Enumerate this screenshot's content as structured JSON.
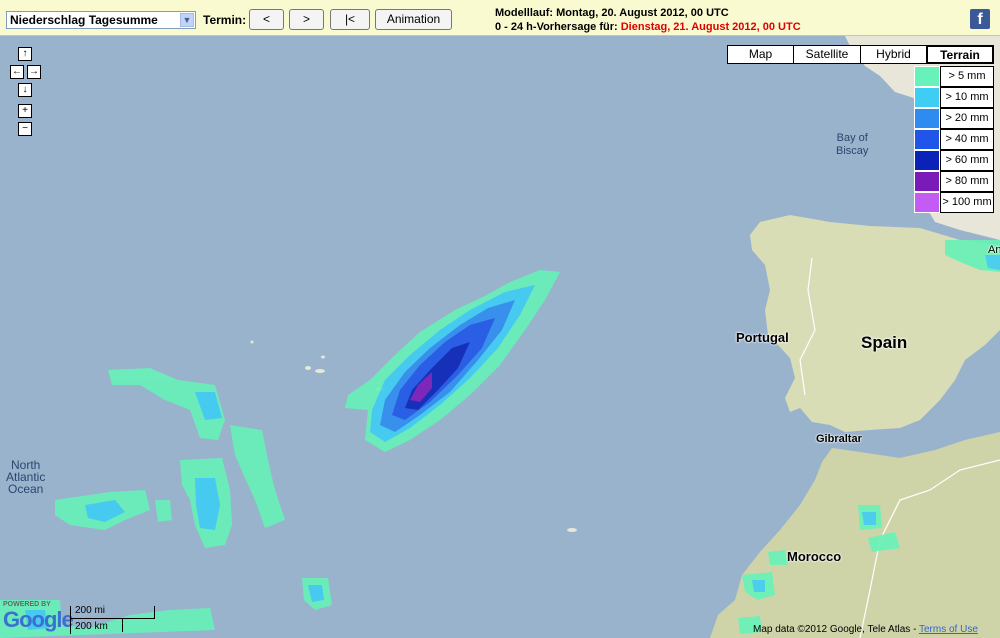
{
  "toolbar": {
    "product_select": "Niederschlag Tagesumme",
    "termin_label": "Termin:",
    "prev_label": "<",
    "next_label": ">",
    "first_label": "|<",
    "animation_label": "Animation",
    "modelllauf": "Modelllauf: Montag, 20. August 2012, 00 UTC",
    "vorhersage_prefix": "0 - 24 h-Vorhersage für:",
    "vorhersage_date": "Dienstag, 21. August 2012, 00 UTC",
    "facebook": "f"
  },
  "nav": {
    "up": "↑",
    "left": "←",
    "right": "→",
    "down": "↓",
    "zoom_in": "+",
    "zoom_out": "−"
  },
  "map_types": [
    "Map",
    "Satellite",
    "Hybrid",
    "Terrain"
  ],
  "legend": [
    {
      "label": "> 5 mm",
      "color": "#66f2b8"
    },
    {
      "label": "> 10 mm",
      "color": "#3fcdf4"
    },
    {
      "label": "> 20 mm",
      "color": "#2e8cf0"
    },
    {
      "label": "> 40 mm",
      "color": "#1f55e8"
    },
    {
      "label": "> 60 mm",
      "color": "#0a22b8"
    },
    {
      "label": "> 80 mm",
      "color": "#7a1ab8"
    },
    {
      "label": "> 100 mm",
      "color": "#c25cf2"
    }
  ],
  "labels": {
    "bay_of_biscay": "Bay of\nBiscay",
    "north_atlantic": "North\nAtlantic\nOcean",
    "portugal": "Portugal",
    "spain": "Spain",
    "gibraltar": "Gibraltar",
    "morocco": "Morocco",
    "andorra": "And"
  },
  "scale": {
    "mi": "200 mi",
    "km": "200 km"
  },
  "google": {
    "powered": "POWERED BY",
    "logo": "Google"
  },
  "attribution": {
    "text": "Map data ©2012 Google, Tele Atlas - ",
    "terms": "Terms of Use"
  }
}
